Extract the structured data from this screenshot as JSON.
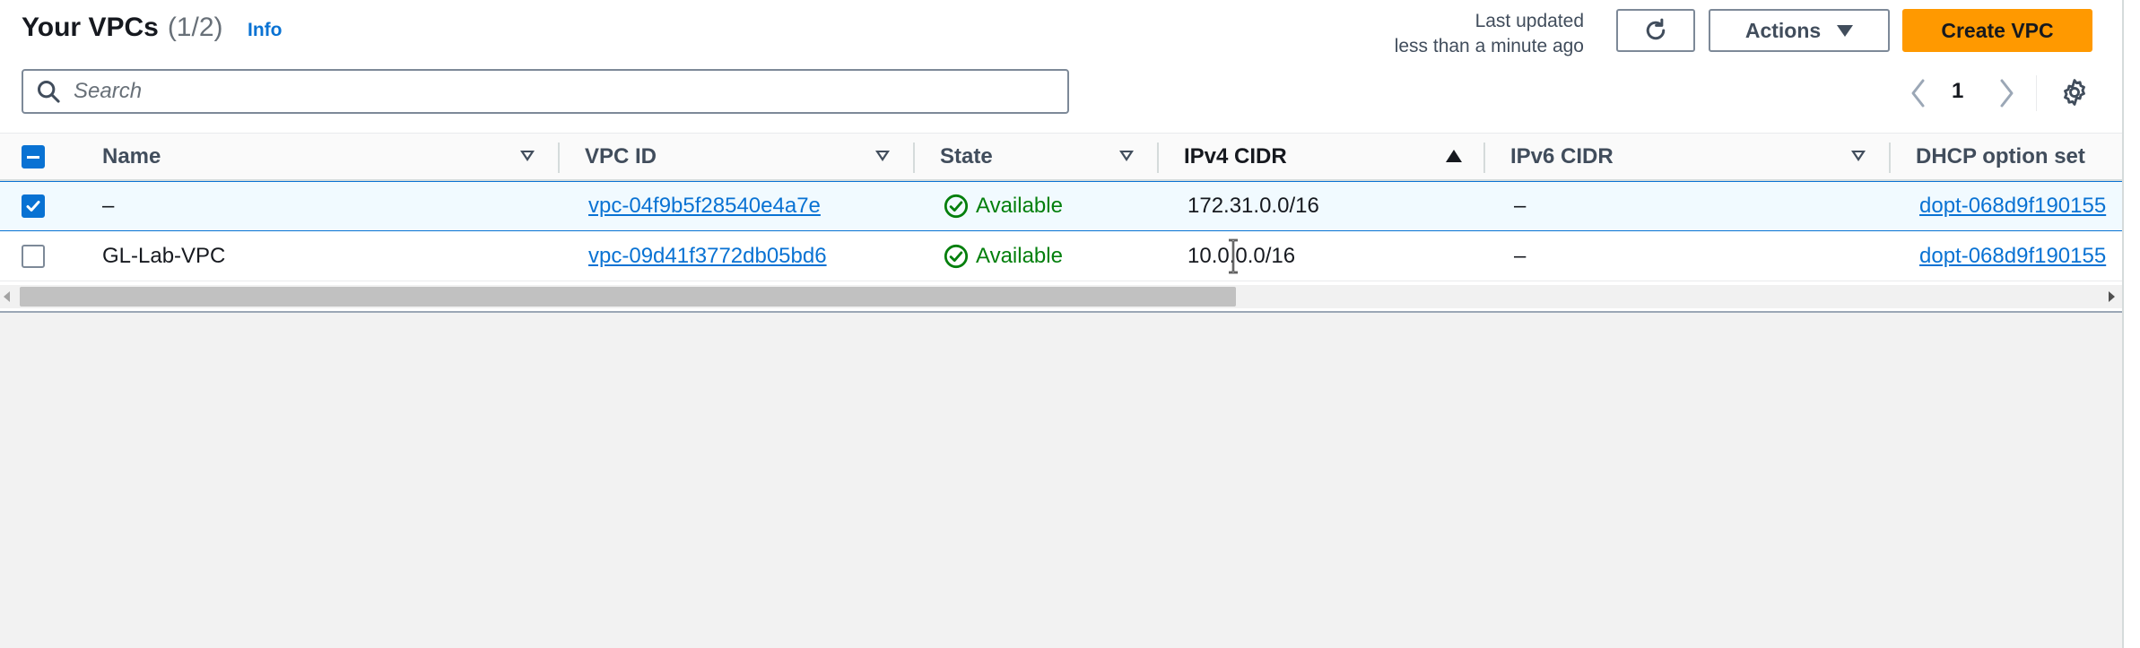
{
  "header": {
    "title": "Your VPCs",
    "count": "(1/2)",
    "info": "Info",
    "last_updated_line1": "Last updated",
    "last_updated_line2": "less than a minute ago",
    "actions_label": "Actions",
    "create_label": "Create VPC"
  },
  "search": {
    "placeholder": "Search",
    "value": ""
  },
  "pagination": {
    "page": "1"
  },
  "table": {
    "columns": {
      "name": "Name",
      "vpc_id": "VPC ID",
      "state": "State",
      "ipv4": "IPv4 CIDR",
      "ipv6": "IPv6 CIDR",
      "dhcp": "DHCP option set"
    },
    "rows": [
      {
        "selected": true,
        "name": "–",
        "vpc_id": "vpc-04f9b5f28540e4a7e",
        "state": "Available",
        "ipv4": "172.31.0.0/16",
        "ipv6": "–",
        "dhcp": "dopt-068d9f190155"
      },
      {
        "selected": false,
        "name": "GL-Lab-VPC",
        "vpc_id": "vpc-09d41f3772db05bd6",
        "state": "Available",
        "ipv4": "10.0.0.0/16",
        "ipv6": "–",
        "dhcp": "dopt-068d9f190155"
      }
    ]
  },
  "colors": {
    "primary": "#ff9900",
    "link": "#0972d3",
    "success": "#037f0c"
  }
}
